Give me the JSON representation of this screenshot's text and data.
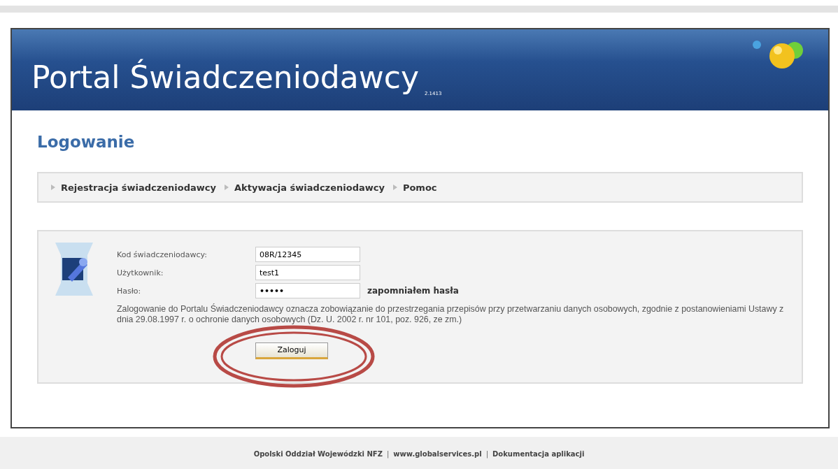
{
  "header": {
    "title": "Portal Świadczeniodawcy",
    "version": "2.1413"
  },
  "heading": "Logowanie",
  "nav": [
    {
      "label": "Rejestracja świadczeniodawcy"
    },
    {
      "label": "Aktywacja świadczeniodawcy"
    },
    {
      "label": "Pomoc"
    }
  ],
  "form": {
    "fields": [
      {
        "label": "Kod świadczeniodawcy:",
        "value": "08R/12345",
        "kind": "text"
      },
      {
        "label": "Użytkownik:",
        "value": "test1",
        "kind": "text"
      },
      {
        "label": "Hasło:",
        "value": "•••••",
        "kind": "password",
        "link": "zapomniałem hasła"
      }
    ],
    "notice": "Zalogowanie do Portalu Świadczeniodawcy oznacza zobowiązanie do przestrzegania przepisów przy przetwarzaniu danych osobowych, zgodnie z postanowieniami Ustawy z dnia 29.08.1997 r. o ochronie danych osobowych (Dz. U. 2002 r. nr 101, poz. 926, ze zm.)",
    "button": "Zaloguj",
    "highlighted": true
  },
  "footer": [
    {
      "kind": "link",
      "label": "Opolski Oddział Wojewódzki NFZ"
    },
    {
      "kind": "separator",
      "label": "|"
    },
    {
      "kind": "link",
      "label": "www.globalservices.pl"
    },
    {
      "kind": "separator",
      "label": "|"
    },
    {
      "kind": "link",
      "label": "Dokumentacja aplikacji"
    }
  ]
}
